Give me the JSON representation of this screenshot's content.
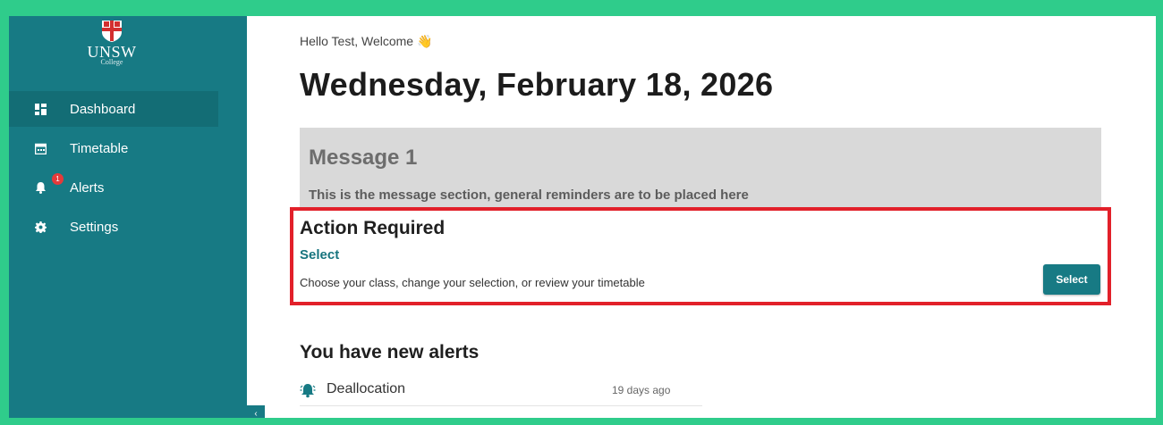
{
  "sidebar": {
    "logo_text": "UNSW",
    "logo_subtext": "College",
    "items": [
      {
        "label": "Dashboard",
        "icon": "dashboard-icon",
        "active": true
      },
      {
        "label": "Timetable",
        "icon": "calendar-icon",
        "active": false
      },
      {
        "label": "Alerts",
        "icon": "bell-icon",
        "active": false,
        "badge": "1"
      },
      {
        "label": "Settings",
        "icon": "gear-icon",
        "active": false
      }
    ],
    "collapse_glyph": "‹"
  },
  "main": {
    "greeting": "Hello Test, Welcome 👋",
    "date": "Wednesday, February 18, 2026",
    "message": {
      "title": "Message 1",
      "body": "This is the message section, general reminders are to be placed here"
    },
    "action": {
      "title": "Action Required",
      "link": "Select",
      "description": "Choose your class, change your selection, or review your timetable",
      "button": "Select"
    },
    "alerts": {
      "heading": "You have new alerts",
      "items": [
        {
          "name": "Deallocation",
          "time": "19 days ago",
          "icon": "alarm-bell-icon"
        }
      ]
    }
  },
  "colors": {
    "sidebar": "#177a84",
    "accent": "#17747e",
    "highlight_border": "#e2202a",
    "background_frame": "#2fcc8b"
  }
}
